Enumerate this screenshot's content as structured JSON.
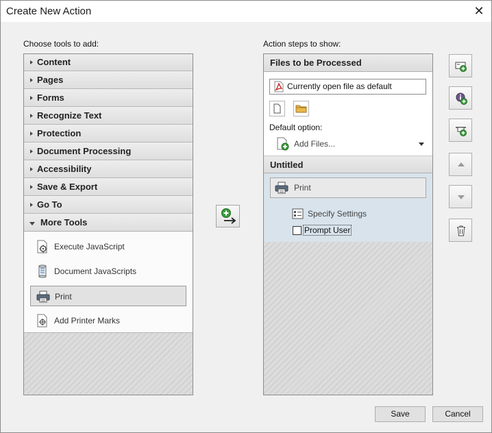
{
  "window": {
    "title": "Create New Action",
    "close_glyph": "✕"
  },
  "left": {
    "label": "Choose tools to add:",
    "categories": [
      {
        "label": "Content",
        "expanded": false
      },
      {
        "label": "Pages",
        "expanded": false
      },
      {
        "label": "Forms",
        "expanded": false
      },
      {
        "label": "Recognize Text",
        "expanded": false
      },
      {
        "label": "Protection",
        "expanded": false
      },
      {
        "label": "Document Processing",
        "expanded": false
      },
      {
        "label": "Accessibility",
        "expanded": false
      },
      {
        "label": "Save & Export",
        "expanded": false
      },
      {
        "label": "Go To",
        "expanded": false
      },
      {
        "label": "More Tools",
        "expanded": true
      }
    ],
    "tools": [
      {
        "label": "Execute JavaScript",
        "icon": "gear-document-icon"
      },
      {
        "label": "Document JavaScripts",
        "icon": "script-scroll-icon"
      },
      {
        "label": "Print",
        "icon": "printer-icon",
        "selected": true
      },
      {
        "label": "Add Printer Marks",
        "icon": "printer-marks-icon"
      }
    ]
  },
  "right": {
    "label": "Action steps to show:",
    "files_header": "Files to be Processed",
    "file_field": "Currently open file as default",
    "default_option_label": "Default option:",
    "default_option_value": "Add Files...",
    "step_group": "Untitled",
    "step_print": "Print",
    "specify_settings": "Specify Settings",
    "prompt_user": "Prompt User"
  },
  "buttons": {
    "save": "Save",
    "cancel": "Cancel"
  }
}
